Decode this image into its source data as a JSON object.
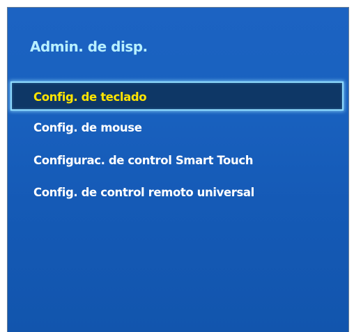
{
  "panel": {
    "title": "Admin. de disp."
  },
  "menu": {
    "items": [
      {
        "label": "Config. de teclado",
        "selected": true
      },
      {
        "label": "Config. de mouse",
        "selected": false
      },
      {
        "label": "Configurac. de control Smart Touch",
        "selected": false
      },
      {
        "label": "Config. de control remoto universal",
        "selected": false
      }
    ]
  },
  "colors": {
    "panel_background": "#1961bf",
    "title_text": "#b8f0ff",
    "item_text": "#ffffff",
    "selected_text": "#ffe400",
    "selected_background": "#0e3766",
    "selected_border": "#8fdcff"
  }
}
